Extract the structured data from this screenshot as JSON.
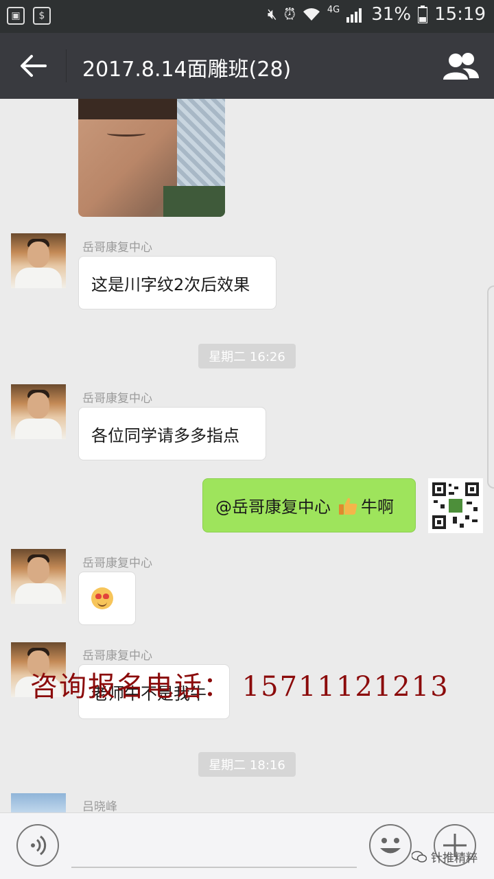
{
  "status_bar": {
    "net": "4G",
    "battery": "31%",
    "time": "15:19"
  },
  "header": {
    "title": "2017.8.14面雕班(28)"
  },
  "messages": [
    {
      "sender": "岳哥康复中心",
      "text": "这是川字纹2次后效果"
    },
    {
      "time": "星期二 16:26"
    },
    {
      "sender": "岳哥康复中心",
      "text": "各位同学请多多指点"
    },
    {
      "self": true,
      "text_mention": "@岳哥康复中心",
      "text_after": "牛啊"
    },
    {
      "sender": "岳哥康复中心",
      "emoji": "heart-eyes-emoji"
    },
    {
      "sender": "岳哥康复中心",
      "text": "老师牛不是我牛"
    },
    {
      "time": "星期二 18:16"
    },
    {
      "sender": "吕晓峰"
    }
  ],
  "watermark": "咨询报名电话：  15711121213",
  "wechat_mark": "针推精粹"
}
